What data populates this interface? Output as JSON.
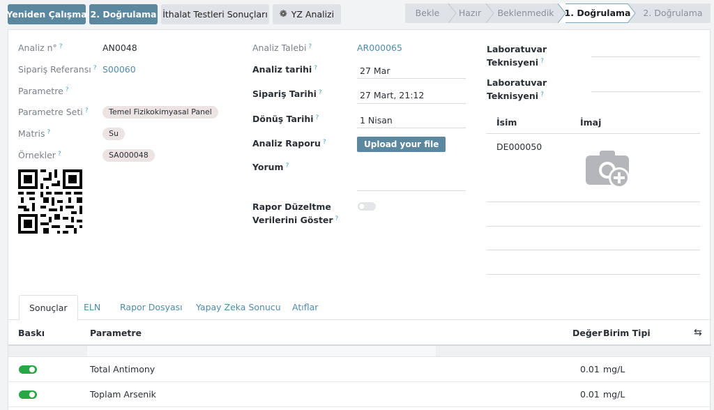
{
  "toolbar": {
    "retest_label": "Yeniden Çalışma",
    "verify2_label": "2. Doğrulama",
    "import_label": "İthalat Testleri Sonuçları",
    "ai_label": "YZ Analizi"
  },
  "statusbar": {
    "stages": [
      "Bekle",
      "Hazır",
      "Beklenmedik",
      "1. Doğrulama",
      "2. Doğrulama"
    ],
    "active": "1. Doğrulama"
  },
  "form": {
    "analysis_no_label": "Analiz n°",
    "analysis_no": "AN0048",
    "order_ref_label": "Sipariş Referansı",
    "order_ref": "S00060",
    "parameter_label": "Parametre",
    "parameter_set_label": "Parametre Seti",
    "parameter_set": "Temel Fizikokimyasal Panel",
    "matrix_label": "Matris",
    "matrix": "Su",
    "samples_label": "Örnekler",
    "sample": "SA000048",
    "analysis_request_label": "Analiz Talebi",
    "analysis_request": "AR000065",
    "analysis_date_label": "Analiz tarihi",
    "analysis_date": "27 Mar",
    "order_date_label": "Sipariş Tarihi",
    "order_date": "27 Mart, 21:12",
    "return_date_label": "Dönüş Tarihi",
    "return_date": "1 Nisan",
    "report_label": "Analiz Raporu",
    "upload_label": "Upload your file",
    "comment_label": "Yorum",
    "show_corrections_label_1": "Rapor Düzeltme",
    "show_corrections_label_2": "Verilerini Göster",
    "lab_tech_1_line1": "Laboratuvar",
    "lab_tech_1_line2": "Teknisyeni",
    "lab_tech_2_line1": "Laboratuvar",
    "lab_tech_2_line2": "Teknisyeni",
    "help_mark": "?"
  },
  "signature_table": {
    "col_name": "İsim",
    "col_image": "İmaj",
    "rows": [
      {
        "name": "DE000050"
      }
    ]
  },
  "tabs": [
    "Sonuçlar",
    "ELN",
    "Rapor Dosyası",
    "Yapay Zeka Sonucu",
    "Atıflar"
  ],
  "results": {
    "headers": {
      "print": "Baskı",
      "parameter": "Parametre",
      "value": "Değer",
      "unit": "Birim Tipi"
    },
    "rows": [
      {
        "parameter": "Total Antimony",
        "value": "0.01",
        "unit": "mg/L",
        "print": true
      },
      {
        "parameter": "Toplam Arsenik",
        "value": "0.01",
        "unit": "mg/L",
        "print": true
      }
    ]
  },
  "colors": {
    "primary": "#5b879f",
    "link": "#4f8bab",
    "toggle_on": "#28a745",
    "help": "#45a7bd"
  }
}
